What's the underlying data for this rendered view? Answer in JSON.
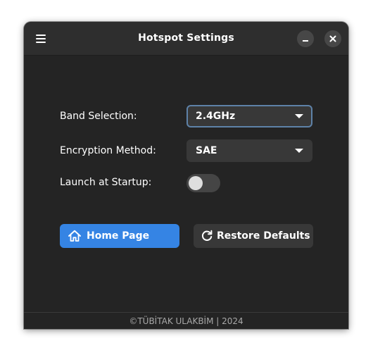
{
  "window": {
    "title": "Hotspot Settings"
  },
  "form": {
    "band_label": "Band Selection:",
    "band_value": "2.4GHz",
    "encryption_label": "Encryption Method:",
    "encryption_value": "SAE",
    "startup_label": "Launch at Startup:",
    "startup_enabled": false
  },
  "buttons": {
    "home_label": "Home Page",
    "restore_label": "Restore Defaults"
  },
  "footer": {
    "text": "©TÜBİTAK ULAKBİM | 2024"
  },
  "icons": {
    "menu": "menu-icon",
    "minimize": "minimize-icon",
    "close": "close-icon",
    "home": "home-icon",
    "restore": "refresh-icon",
    "dropdown": "chevron-down-icon"
  },
  "colors": {
    "accent": "#3584e4",
    "window_bg": "#242424",
    "header_bg": "#2e2e2e",
    "focus_border": "#5e82a8"
  }
}
